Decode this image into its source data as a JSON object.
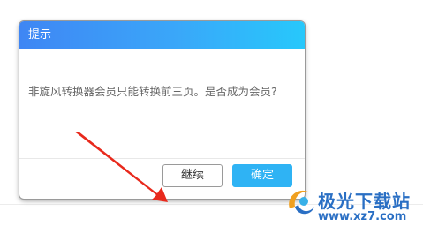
{
  "dialog": {
    "title": "提示",
    "message": "非旋风转换器会员只能转换前三页。是否成为会员?",
    "continue_label": "继续",
    "confirm_label": "确定"
  },
  "watermark": {
    "site_name": "极光下载站",
    "url": "www.xz7.com"
  },
  "colors": {
    "header_start": "#3f86f4",
    "header_end": "#27c8fb",
    "confirm_button": "#2fb3f4",
    "arrow": "#e8291c"
  }
}
